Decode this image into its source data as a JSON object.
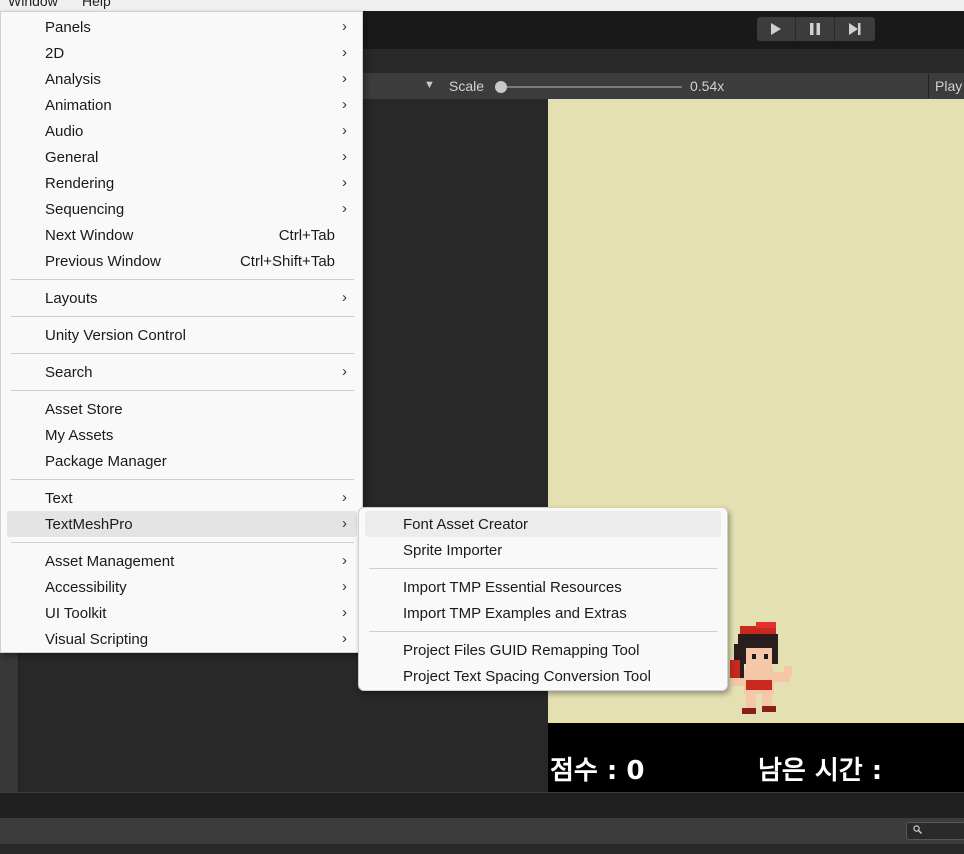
{
  "menubar": {
    "window": "Window",
    "help": "Help"
  },
  "game_toolbar": {
    "scale_label": "Scale",
    "scale_value": "0.54x",
    "scale_fraction": 0.02,
    "play_tab": "Play"
  },
  "game": {
    "score_label": "점수 : 0",
    "time_label": "남은 시간 :"
  },
  "window_menu": {
    "items": [
      {
        "label": "Panels",
        "submenu": true
      },
      {
        "label": "2D",
        "submenu": true
      },
      {
        "label": "Analysis",
        "submenu": true
      },
      {
        "label": "Animation",
        "submenu": true
      },
      {
        "label": "Audio",
        "submenu": true
      },
      {
        "label": "General",
        "submenu": true
      },
      {
        "label": "Rendering",
        "submenu": true
      },
      {
        "label": "Sequencing",
        "submenu": true
      },
      {
        "label": "Next Window",
        "shortcut": "Ctrl+Tab"
      },
      {
        "label": "Previous Window",
        "shortcut": "Ctrl+Shift+Tab"
      },
      {
        "label": "Layouts",
        "submenu": true
      },
      {
        "label": "Unity Version Control"
      },
      {
        "label": "Search",
        "submenu": true
      },
      {
        "label": "Asset Store"
      },
      {
        "label": "My Assets"
      },
      {
        "label": "Package Manager"
      },
      {
        "label": "Text",
        "submenu": true
      },
      {
        "label": "TextMeshPro",
        "submenu": true,
        "highlighted": true
      },
      {
        "label": "Asset Management",
        "submenu": true
      },
      {
        "label": "Accessibility",
        "submenu": true
      },
      {
        "label": "UI Toolkit",
        "submenu": true
      },
      {
        "label": "Visual Scripting",
        "submenu": true
      }
    ],
    "arrow_glyph": "›"
  },
  "textmeshpro_submenu": {
    "items": [
      {
        "label": "Font Asset Creator",
        "highlighted": true
      },
      {
        "label": "Sprite Importer"
      },
      {
        "label": "Import TMP Essential Resources"
      },
      {
        "label": "Import TMP Examples and Extras"
      },
      {
        "label": "Project Files GUID Remapping Tool"
      },
      {
        "label": "Project Text Spacing Conversion Tool"
      }
    ]
  },
  "icons": {
    "play": "play-icon",
    "pause": "pause-icon",
    "step": "step-icon",
    "search": "search-icon"
  }
}
